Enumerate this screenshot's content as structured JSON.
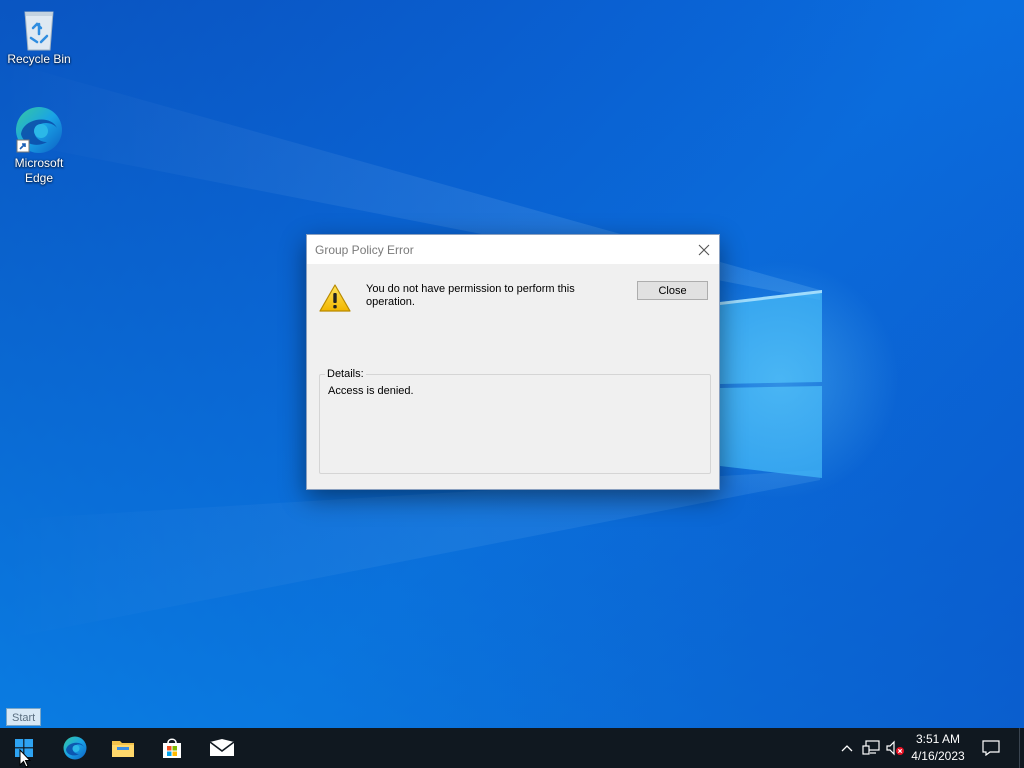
{
  "desktop": {
    "icons": [
      {
        "label": "Recycle Bin",
        "icon": "recycle-bin-icon"
      },
      {
        "label": "Microsoft Edge",
        "icon": "edge-icon"
      }
    ]
  },
  "dialog": {
    "title": "Group Policy Error",
    "message": "You do not have permission to perform this operation.",
    "close_label": "Close",
    "details_label": "Details:",
    "details_text": "Access is denied.",
    "icon": "warning-icon"
  },
  "taskbar": {
    "start_tooltip": "Start",
    "pinned": [
      {
        "name": "start-button",
        "icon": "windows-logo-icon"
      },
      {
        "name": "edge",
        "icon": "edge-icon"
      },
      {
        "name": "file-explorer",
        "icon": "folder-icon"
      },
      {
        "name": "microsoft-store",
        "icon": "store-icon"
      },
      {
        "name": "mail",
        "icon": "mail-icon"
      }
    ],
    "tray": {
      "time": "3:51 AM",
      "date": "4/16/2023",
      "icons": [
        "chevron-up-icon",
        "network-icon",
        "volume-muted-icon",
        "notification-icon"
      ]
    }
  },
  "colors": {
    "wallpaper": "#0a63d6",
    "taskbar": "#101820",
    "dialog_bg": "#f0f0f0"
  }
}
